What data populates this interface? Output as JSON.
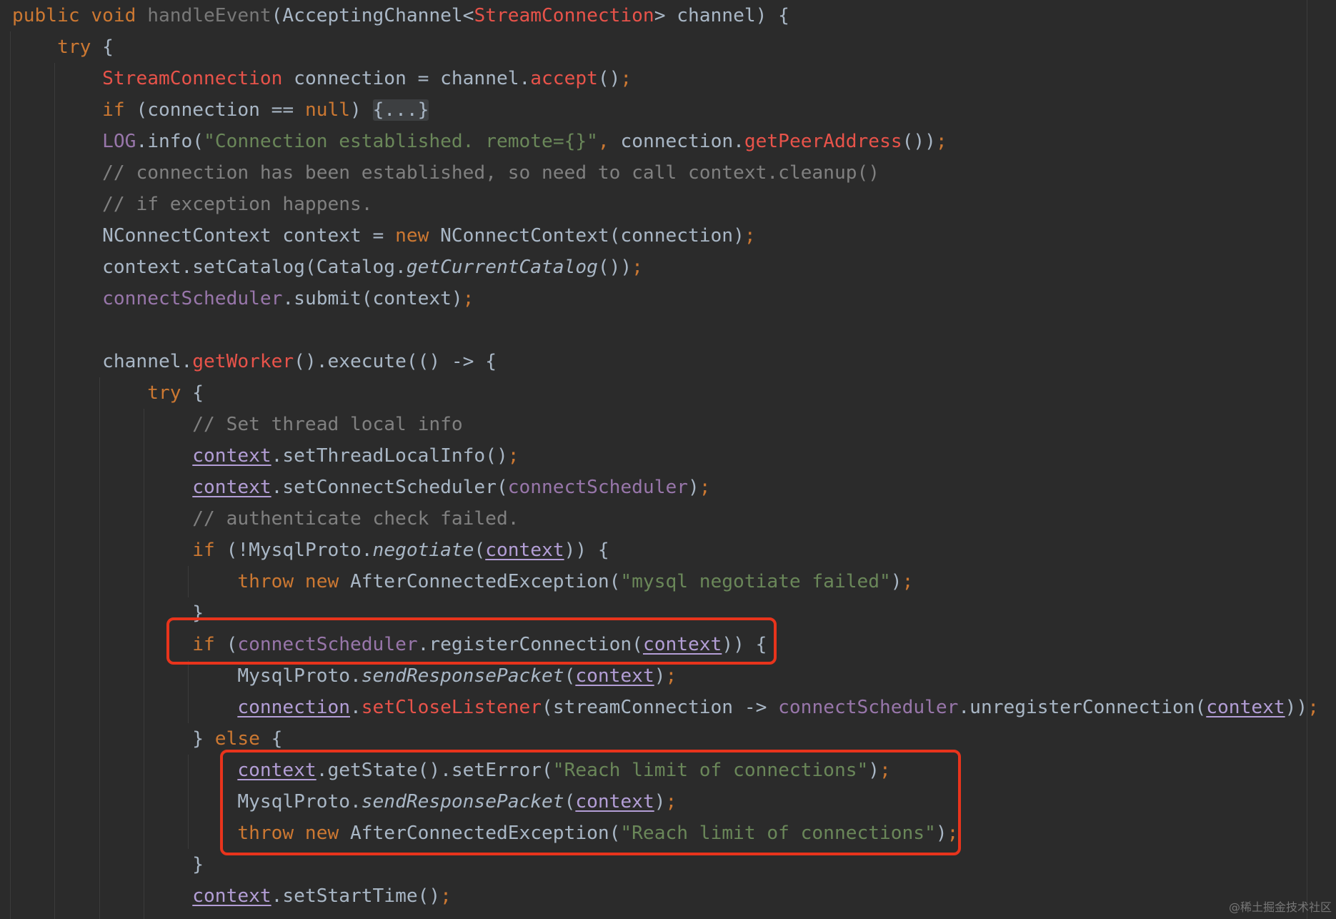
{
  "code_lines": [
    [
      {
        "t": "public void ",
        "c": "kw"
      },
      {
        "t": "handleEvent",
        "c": "fn"
      },
      {
        "t": "(AcceptingChannel<"
      },
      {
        "t": "StreamConnection",
        "c": "type"
      },
      {
        "t": "> channel) {"
      }
    ],
    [
      {
        "t": "    "
      },
      {
        "t": "try",
        "c": "kw"
      },
      {
        "t": " {"
      }
    ],
    [
      {
        "t": "        "
      },
      {
        "t": "StreamConnection",
        "c": "type"
      },
      {
        "t": " connection = channel."
      },
      {
        "t": "accept",
        "c": "call"
      },
      {
        "t": "()"
      },
      {
        "t": ";",
        "c": "punct"
      }
    ],
    [
      {
        "t": "        "
      },
      {
        "t": "if",
        "c": "kw"
      },
      {
        "t": " (connection == "
      },
      {
        "t": "null",
        "c": "kw"
      },
      {
        "t": ") "
      },
      {
        "t": "{...}",
        "c": "fold"
      }
    ],
    [
      {
        "t": "        "
      },
      {
        "t": "LOG",
        "c": "field"
      },
      {
        "t": ".info("
      },
      {
        "t": "\"Connection established. remote={}\"",
        "c": "str"
      },
      {
        "t": ", ",
        "c": "punct"
      },
      {
        "t": "connection."
      },
      {
        "t": "getPeerAddress",
        "c": "call"
      },
      {
        "t": "())"
      },
      {
        "t": ";",
        "c": "punct"
      }
    ],
    [
      {
        "t": "        "
      },
      {
        "t": "// connection has been established, so need to call context.cleanup()",
        "c": "cm"
      }
    ],
    [
      {
        "t": "        "
      },
      {
        "t": "// if exception happens.",
        "c": "cm"
      }
    ],
    [
      {
        "t": "        NConnectContext context = "
      },
      {
        "t": "new",
        "c": "kw"
      },
      {
        "t": " NConnectContext(connection)"
      },
      {
        "t": ";",
        "c": "punct"
      }
    ],
    [
      {
        "t": "        context.setCatalog(Catalog."
      },
      {
        "t": "getCurrentCatalog",
        "c": "ital"
      },
      {
        "t": "())"
      },
      {
        "t": ";",
        "c": "punct"
      }
    ],
    [
      {
        "t": "        "
      },
      {
        "t": "connectScheduler",
        "c": "field"
      },
      {
        "t": ".submit(context)"
      },
      {
        "t": ";",
        "c": "punct"
      }
    ],
    [
      {
        "t": ""
      }
    ],
    [
      {
        "t": "        channel."
      },
      {
        "t": "getWorker",
        "c": "call"
      },
      {
        "t": "().execute(() -> {"
      }
    ],
    [
      {
        "t": "            "
      },
      {
        "t": "try",
        "c": "kw"
      },
      {
        "t": " {"
      }
    ],
    [
      {
        "t": "                "
      },
      {
        "t": "// Set thread local info",
        "c": "cm"
      }
    ],
    [
      {
        "t": "                "
      },
      {
        "t": "context",
        "c": "uv"
      },
      {
        "t": ".setThreadLocalInfo()"
      },
      {
        "t": ";",
        "c": "punct"
      }
    ],
    [
      {
        "t": "                "
      },
      {
        "t": "context",
        "c": "uv"
      },
      {
        "t": ".setConnectScheduler("
      },
      {
        "t": "connectScheduler",
        "c": "field"
      },
      {
        "t": ")"
      },
      {
        "t": ";",
        "c": "punct"
      }
    ],
    [
      {
        "t": "                "
      },
      {
        "t": "// authenticate check failed.",
        "c": "cm"
      }
    ],
    [
      {
        "t": "                "
      },
      {
        "t": "if",
        "c": "kw"
      },
      {
        "t": " (!MysqlProto."
      },
      {
        "t": "negotiate",
        "c": "ital"
      },
      {
        "t": "("
      },
      {
        "t": "context",
        "c": "uv"
      },
      {
        "t": ")) {"
      }
    ],
    [
      {
        "t": "                    "
      },
      {
        "t": "throw new",
        "c": "kw"
      },
      {
        "t": " AfterConnectedException("
      },
      {
        "t": "\"mysql negotiate failed\"",
        "c": "str"
      },
      {
        "t": ")"
      },
      {
        "t": ";",
        "c": "punct"
      }
    ],
    [
      {
        "t": "                }"
      }
    ],
    [
      {
        "t": "                "
      },
      {
        "t": "if",
        "c": "kw"
      },
      {
        "t": " ("
      },
      {
        "t": "connectScheduler",
        "c": "field"
      },
      {
        "t": ".registerConnection("
      },
      {
        "t": "context",
        "c": "uv"
      },
      {
        "t": ")) {"
      }
    ],
    [
      {
        "t": "                    MysqlProto."
      },
      {
        "t": "sendResponsePacket",
        "c": "ital"
      },
      {
        "t": "("
      },
      {
        "t": "context",
        "c": "uv"
      },
      {
        "t": ")"
      },
      {
        "t": ";",
        "c": "punct"
      }
    ],
    [
      {
        "t": "                    "
      },
      {
        "t": "connection",
        "c": "uv"
      },
      {
        "t": "."
      },
      {
        "t": "setCloseListener",
        "c": "call"
      },
      {
        "t": "(streamConnection -> "
      },
      {
        "t": "connectScheduler",
        "c": "field"
      },
      {
        "t": ".unregisterConnection("
      },
      {
        "t": "context",
        "c": "uv"
      },
      {
        "t": "))"
      },
      {
        "t": ";",
        "c": "punct"
      }
    ],
    [
      {
        "t": "                } "
      },
      {
        "t": "else",
        "c": "kw"
      },
      {
        "t": " {"
      }
    ],
    [
      {
        "t": "                    "
      },
      {
        "t": "context",
        "c": "uv"
      },
      {
        "t": ".getState().setError("
      },
      {
        "t": "\"Reach limit of connections\"",
        "c": "str"
      },
      {
        "t": ")"
      },
      {
        "t": ";",
        "c": "punct"
      }
    ],
    [
      {
        "t": "                    MysqlProto."
      },
      {
        "t": "sendResponsePacket",
        "c": "ital"
      },
      {
        "t": "("
      },
      {
        "t": "context",
        "c": "uv"
      },
      {
        "t": ")"
      },
      {
        "t": ";",
        "c": "punct"
      }
    ],
    [
      {
        "t": "                    "
      },
      {
        "t": "throw new",
        "c": "kw"
      },
      {
        "t": " AfterConnectedException("
      },
      {
        "t": "\"Reach limit of connections\"",
        "c": "str"
      },
      {
        "t": ")"
      },
      {
        "t": ";",
        "c": "punct"
      }
    ],
    [
      {
        "t": "                }"
      }
    ],
    [
      {
        "t": "                "
      },
      {
        "t": "context",
        "c": "uv"
      },
      {
        "t": ".setStartTime()"
      },
      {
        "t": ";",
        "c": "punct"
      }
    ]
  ],
  "watermark": "@稀土掘金技术社区",
  "colors": {
    "background": "#2b2b2b",
    "keyword": "#cc7832",
    "string": "#6a8759",
    "comment": "#808080",
    "field": "#9876aa",
    "type_red": "#e8534a",
    "highlight_box": "#e8341c"
  }
}
